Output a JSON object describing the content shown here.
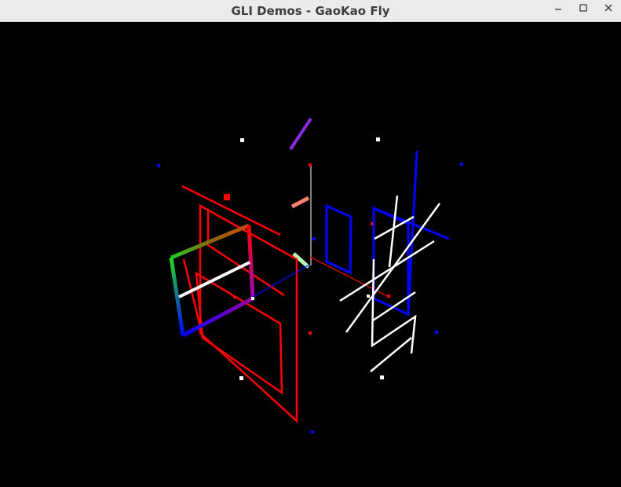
{
  "window": {
    "title": "GLI Demos - GaoKao Fly",
    "minimize_icon": "minimize-icon",
    "maximize_icon": "maximize-icon",
    "close_icon": "close-icon"
  },
  "scene": {
    "background": "#000000",
    "colors": {
      "red": "#ff0000",
      "blue": "#0000ff",
      "white": "#ffffff",
      "purple": "#8a2be2",
      "salmon": "#fa8072",
      "lightgreen": "#b7ffb0"
    }
  }
}
